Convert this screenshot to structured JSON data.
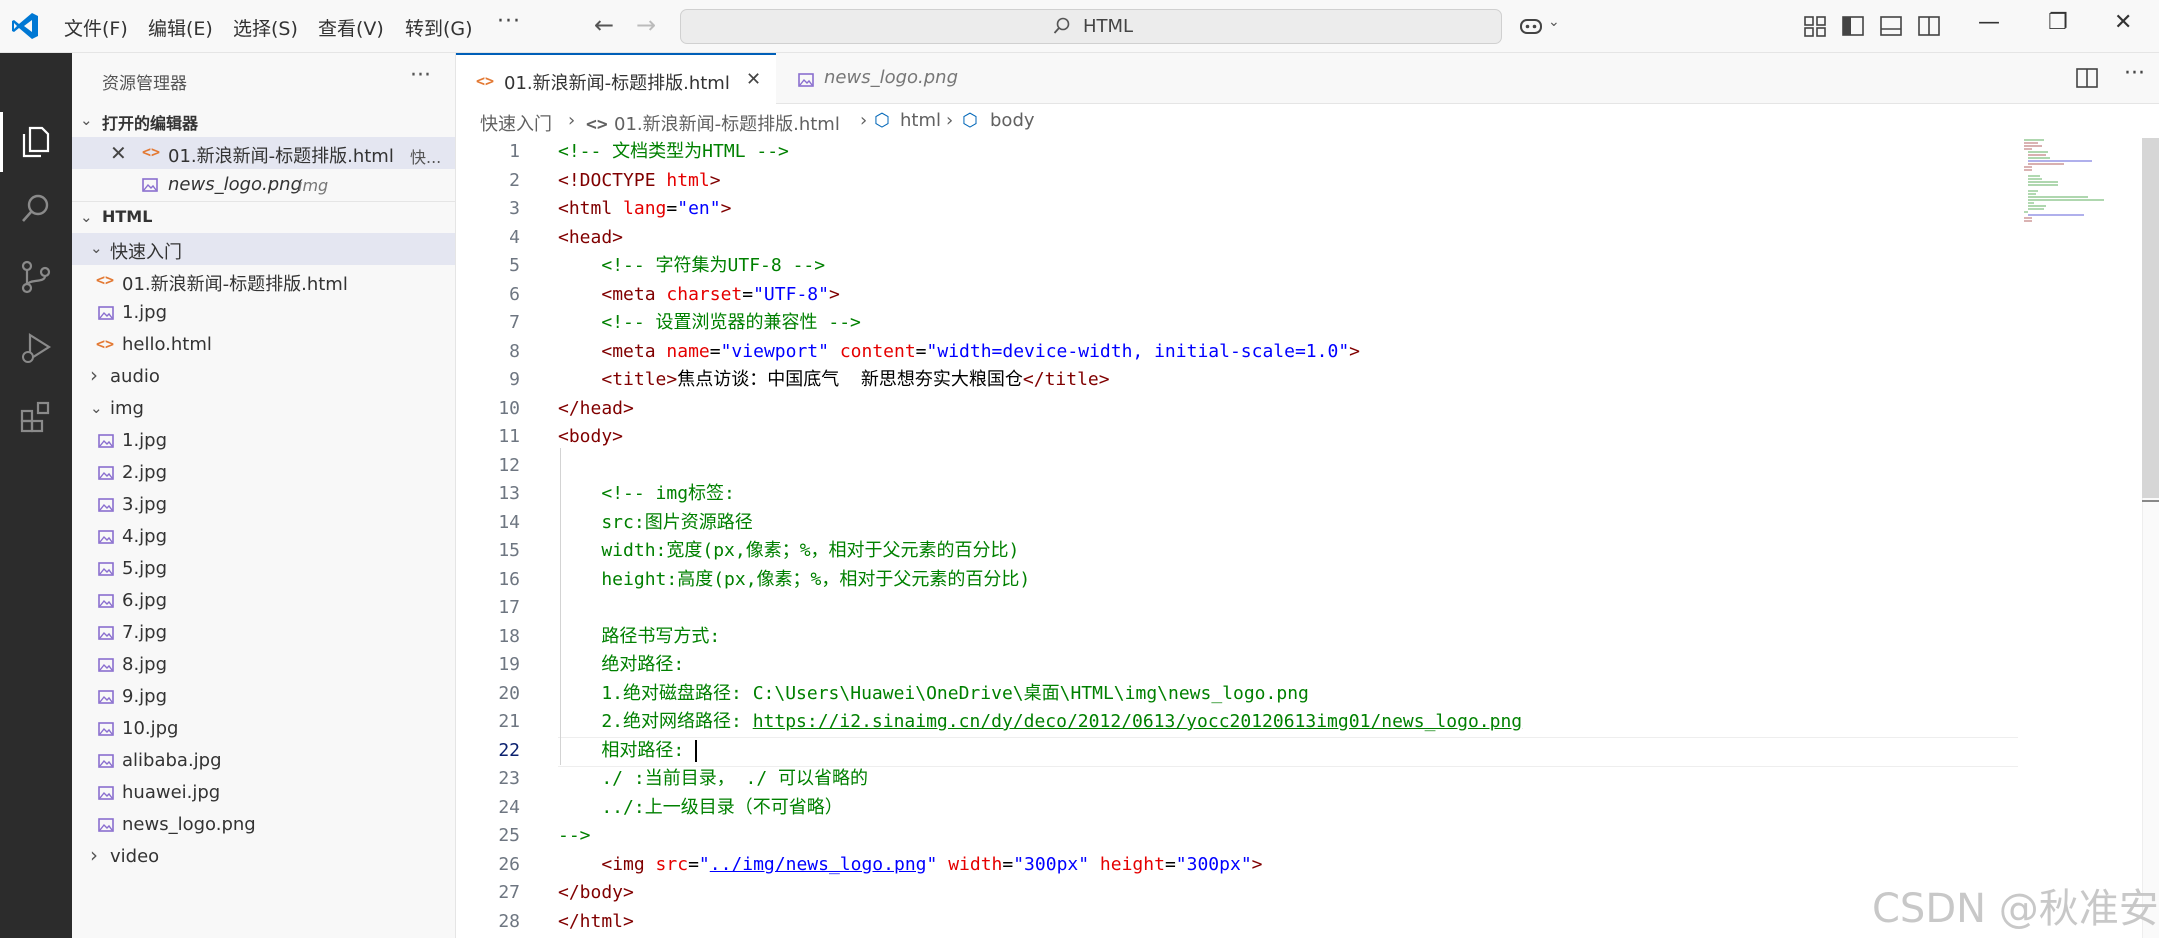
{
  "titlebar": {
    "menu": [
      "文件(F)",
      "编辑(E)",
      "选择(S)",
      "查看(V)",
      "转到(G)"
    ],
    "more": "···",
    "search_text": "HTML"
  },
  "sidebar": {
    "title": "资源管理器",
    "more": "···",
    "open_editors_label": "打开的编辑器",
    "open_editors": [
      {
        "name": "01.新浪新闻-标题排版.html",
        "desc": "快...",
        "type": "html"
      },
      {
        "name": "news_logo.png",
        "desc": "img",
        "type": "image"
      }
    ],
    "folder_label": "HTML",
    "tree": [
      {
        "name": "快速入门",
        "kind": "folder-open"
      },
      {
        "name": "01.新浪新闻-标题排版.html",
        "kind": "html"
      },
      {
        "name": "1.jpg",
        "kind": "image"
      },
      {
        "name": "hello.html",
        "kind": "html"
      },
      {
        "name": "audio",
        "kind": "folder-closed"
      },
      {
        "name": "img",
        "kind": "folder-open"
      },
      {
        "name": "1.jpg",
        "kind": "image"
      },
      {
        "name": "2.jpg",
        "kind": "image"
      },
      {
        "name": "3.jpg",
        "kind": "image"
      },
      {
        "name": "4.jpg",
        "kind": "image"
      },
      {
        "name": "5.jpg",
        "kind": "image"
      },
      {
        "name": "6.jpg",
        "kind": "image"
      },
      {
        "name": "7.jpg",
        "kind": "image"
      },
      {
        "name": "8.jpg",
        "kind": "image"
      },
      {
        "name": "9.jpg",
        "kind": "image"
      },
      {
        "name": "10.jpg",
        "kind": "image"
      },
      {
        "name": "alibaba.jpg",
        "kind": "image"
      },
      {
        "name": "huawei.jpg",
        "kind": "image"
      },
      {
        "name": "news_logo.png",
        "kind": "image"
      },
      {
        "name": "video",
        "kind": "folder-closed"
      }
    ]
  },
  "tabs": [
    {
      "label": "01.新浪新闻-标题排版.html",
      "active": true
    },
    {
      "label": "news_logo.png",
      "active": false
    }
  ],
  "breadcrumb": [
    "快速入门",
    "01.新浪新闻-标题排版.html",
    "html",
    "body"
  ],
  "editor": {
    "line_numbers": [
      "1",
      "2",
      "3",
      "4",
      "5",
      "6",
      "7",
      "8",
      "9",
      "10",
      "11",
      "12",
      "13",
      "14",
      "15",
      "16",
      "17",
      "18",
      "19",
      "20",
      "21",
      "22",
      "23",
      "24",
      "25",
      "26",
      "27",
      "28"
    ],
    "current_line": "22",
    "lines": [
      [
        {
          "t": "<!-- 文档类型为HTML -->",
          "c": "cm"
        }
      ],
      [
        {
          "t": "<!DOCTYPE ",
          "c": "tg"
        },
        {
          "t": "html",
          "c": "at"
        },
        {
          "t": ">",
          "c": "tg"
        }
      ],
      [
        {
          "t": "<html ",
          "c": "tg"
        },
        {
          "t": "lang",
          "c": "at"
        },
        {
          "t": "=",
          "c": "tx"
        },
        {
          "t": "\"en\"",
          "c": "st"
        },
        {
          "t": ">",
          "c": "tg"
        }
      ],
      [
        {
          "t": "<head>",
          "c": "tg"
        }
      ],
      [
        {
          "t": "    ",
          "c": "tx"
        },
        {
          "t": "<!-- 字符集为UTF-8 -->",
          "c": "cm"
        }
      ],
      [
        {
          "t": "    ",
          "c": "tx"
        },
        {
          "t": "<meta ",
          "c": "tg"
        },
        {
          "t": "charset",
          "c": "at"
        },
        {
          "t": "=",
          "c": "tx"
        },
        {
          "t": "\"UTF-8\"",
          "c": "st"
        },
        {
          "t": ">",
          "c": "tg"
        }
      ],
      [
        {
          "t": "    ",
          "c": "tx"
        },
        {
          "t": "<!-- 设置浏览器的兼容性 -->",
          "c": "cm"
        }
      ],
      [
        {
          "t": "    ",
          "c": "tx"
        },
        {
          "t": "<meta ",
          "c": "tg"
        },
        {
          "t": "name",
          "c": "at"
        },
        {
          "t": "=",
          "c": "tx"
        },
        {
          "t": "\"viewport\"",
          "c": "st"
        },
        {
          "t": " ",
          "c": "tx"
        },
        {
          "t": "content",
          "c": "at"
        },
        {
          "t": "=",
          "c": "tx"
        },
        {
          "t": "\"width=device-width, initial-scale=1.0\"",
          "c": "st"
        },
        {
          "t": ">",
          "c": "tg"
        }
      ],
      [
        {
          "t": "    ",
          "c": "tx"
        },
        {
          "t": "<title>",
          "c": "tg"
        },
        {
          "t": "焦点访谈：中国底气  新思想夯实大粮国仓",
          "c": "tx"
        },
        {
          "t": "</title>",
          "c": "tg"
        }
      ],
      [
        {
          "t": "</head>",
          "c": "tg"
        }
      ],
      [
        {
          "t": "<body>",
          "c": "tg"
        }
      ],
      [
        {
          "t": "",
          "c": "tx"
        }
      ],
      [
        {
          "t": "    ",
          "c": "tx"
        },
        {
          "t": "<!-- img标签:",
          "c": "cm"
        }
      ],
      [
        {
          "t": "    src:图片资源路径",
          "c": "cm"
        }
      ],
      [
        {
          "t": "    width:宽度(px,像素；%，相对于父元素的百分比)",
          "c": "cm"
        }
      ],
      [
        {
          "t": "    height:高度(px,像素；%，相对于父元素的百分比)",
          "c": "cm"
        }
      ],
      [
        {
          "t": "",
          "c": "cm"
        }
      ],
      [
        {
          "t": "    路径书写方式:",
          "c": "cm"
        }
      ],
      [
        {
          "t": "    绝对路径:",
          "c": "cm"
        }
      ],
      [
        {
          "t": "    1.绝对磁盘路径: C:\\Users\\Huawei\\OneDrive\\桌面\\HTML\\img\\news_logo.png",
          "c": "cm"
        }
      ],
      [
        {
          "t": "    2.绝对网络路径: ",
          "c": "cm"
        },
        {
          "t": "https://i2.sinaimg.cn/dy/deco/2012/0613/yocc20120613img01/news_logo.png",
          "c": "cm lk"
        }
      ],
      [
        {
          "t": "    相对路径: ",
          "c": "cm"
        }
      ],
      [
        {
          "t": "    ./ :当前目录， ./ 可以省略的",
          "c": "cm"
        }
      ],
      [
        {
          "t": "    ../:上一级目录（不可省略）",
          "c": "cm"
        }
      ],
      [
        {
          "t": "-->",
          "c": "cm"
        }
      ],
      [
        {
          "t": "    ",
          "c": "tx"
        },
        {
          "t": "<img ",
          "c": "tg"
        },
        {
          "t": "src",
          "c": "at"
        },
        {
          "t": "=",
          "c": "tx"
        },
        {
          "t": "\"",
          "c": "st"
        },
        {
          "t": "../img/news_logo.png",
          "c": "st lk"
        },
        {
          "t": "\"",
          "c": "st"
        },
        {
          "t": " ",
          "c": "tx"
        },
        {
          "t": "width",
          "c": "at"
        },
        {
          "t": "=",
          "c": "tx"
        },
        {
          "t": "\"300px\"",
          "c": "st"
        },
        {
          "t": " ",
          "c": "tx"
        },
        {
          "t": "height",
          "c": "at"
        },
        {
          "t": "=",
          "c": "tx"
        },
        {
          "t": "\"300px\"",
          "c": "st"
        },
        {
          "t": ">",
          "c": "tg"
        }
      ],
      [
        {
          "t": "</body>",
          "c": "tg"
        }
      ],
      [
        {
          "t": "</html>",
          "c": "tg"
        }
      ]
    ]
  },
  "watermark": "CSDN @秋准安",
  "colors": {
    "accent": "#005fb8",
    "activitybar": "#2c2c2c",
    "comment": "#008000",
    "tag": "#800000",
    "attribute": "#e50000",
    "string": "#0000ff"
  }
}
